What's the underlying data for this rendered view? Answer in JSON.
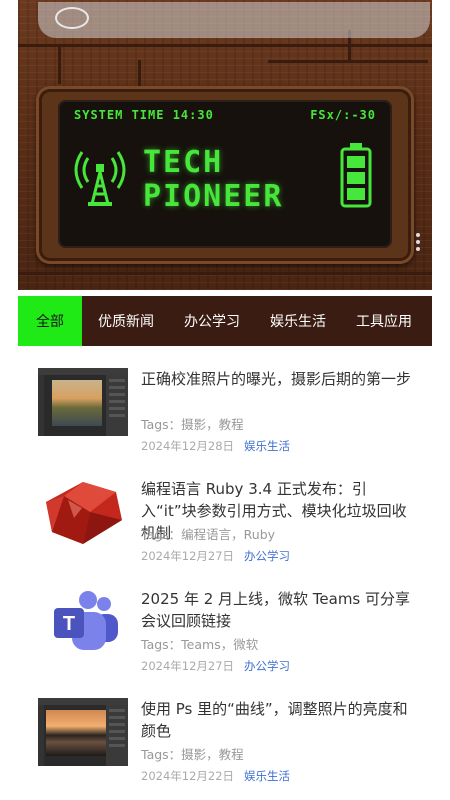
{
  "hero": {
    "system_time": "SYSTEM TIME 14:30",
    "fps": "FSx/:-30",
    "title_line1": "TECH",
    "title_line2": "PIONEER"
  },
  "tabs": [
    {
      "label": "全部",
      "active": true
    },
    {
      "label": "优质新闻"
    },
    {
      "label": "办公学习"
    },
    {
      "label": "娱乐生活"
    },
    {
      "label": "工具应用"
    }
  ],
  "articles": [
    {
      "title": "正确校准照片的曝光，摄影后期的第一步",
      "tags": "Tags：摄影，教程",
      "date": "2024年12月28日",
      "category": "娱乐生活",
      "thumb": "photoshop-lake-thumbnail"
    },
    {
      "title": "编程语言 Ruby 3.4 正式发布：引入“it”块参数引用方式、模块化垃圾回收机制",
      "tags": "Tags：编程语言，Ruby",
      "date": "2024年12月27日",
      "category": "办公学习",
      "thumb": "ruby-gem-icon"
    },
    {
      "title": "2025 年 2 月上线，微软 Teams 可分享会议回顾链接",
      "tags": "Tags：Teams，微软",
      "date": "2024年12月27日",
      "category": "办公学习",
      "thumb": "teams-icon"
    },
    {
      "title": "使用 Ps 里的“曲线”，调整照片的亮度和颜色",
      "tags": "Tags：摄影，教程",
      "date": "2024年12月22日",
      "category": "娱乐生活",
      "thumb": "photoshop-sunset-thumbnail"
    }
  ],
  "colors": {
    "accent_green": "#1fea16",
    "tab_bar": "#3a1c12",
    "category_link": "#3f6fd1",
    "screen_green": "#47e63a"
  }
}
